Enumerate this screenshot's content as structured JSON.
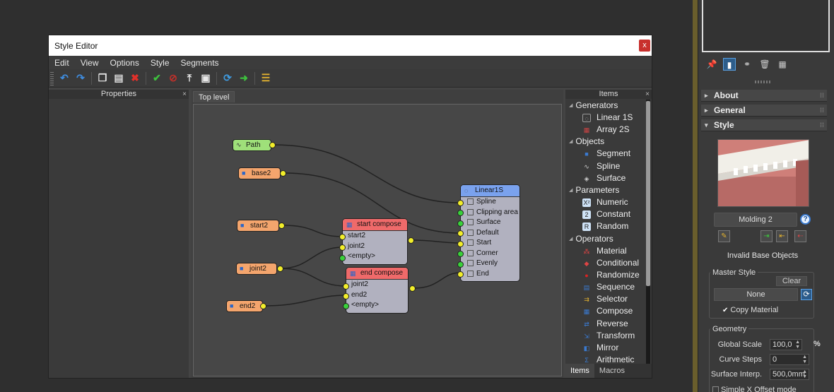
{
  "window": {
    "title": "Style Editor",
    "close_label": "x"
  },
  "menu": [
    "Edit",
    "View",
    "Options",
    "Style",
    "Segments"
  ],
  "panels": {
    "properties": "Properties",
    "items": "Items",
    "top_tab": "Top level"
  },
  "graph": {
    "inputs": {
      "path": "Path",
      "base2": "base2",
      "start2": "start2",
      "joint2": "joint2",
      "end2": "end2"
    },
    "start_compose": {
      "title": "start compose",
      "ports": [
        "start2",
        "joint2",
        "<empty>"
      ]
    },
    "end_compose": {
      "title": "end compose",
      "ports": [
        "joint2",
        "end2",
        "<empty>"
      ]
    },
    "linear": {
      "title": "Linear1S",
      "ports": [
        "Spline",
        "Clipping area",
        "Surface",
        "Default",
        "Start",
        "Corner",
        "Evenly",
        "End"
      ]
    }
  },
  "items": [
    {
      "category": "Generators",
      "entries": [
        {
          "label": "Linear 1S",
          "icon": "linear-icon"
        },
        {
          "label": "Array 2S",
          "icon": "array-icon"
        }
      ]
    },
    {
      "category": "Objects",
      "entries": [
        {
          "label": "Segment",
          "icon": "segment-icon"
        },
        {
          "label": "Spline",
          "icon": "spline-icon"
        },
        {
          "label": "Surface",
          "icon": "surface-icon"
        }
      ]
    },
    {
      "category": "Parameters",
      "entries": [
        {
          "label": "Numeric",
          "icon": "numeric-icon"
        },
        {
          "label": "Constant",
          "icon": "constant-icon"
        },
        {
          "label": "Random",
          "icon": "random-icon"
        }
      ]
    },
    {
      "category": "Operators",
      "entries": [
        {
          "label": "Material",
          "icon": "material-icon"
        },
        {
          "label": "Conditional",
          "icon": "conditional-icon"
        },
        {
          "label": "Randomize",
          "icon": "randomize-icon"
        },
        {
          "label": "Sequence",
          "icon": "sequence-icon"
        },
        {
          "label": "Selector",
          "icon": "selector-icon"
        },
        {
          "label": "Compose",
          "icon": "compose-icon"
        },
        {
          "label": "Reverse",
          "icon": "reverse-icon"
        },
        {
          "label": "Transform",
          "icon": "transform-icon"
        },
        {
          "label": "Mirror",
          "icon": "mirror-icon"
        },
        {
          "label": "Arithmetic",
          "icon": "arithmetic-icon"
        }
      ]
    }
  ],
  "items_tabs": {
    "items": "Items",
    "macros": "Macros"
  },
  "right_panel": {
    "rollouts": {
      "about": "About",
      "general": "General",
      "style": "Style"
    },
    "style_name": "Molding 2",
    "status": "Invalid Base Objects",
    "master_style": {
      "label": "Master Style",
      "clear": "Clear",
      "value": "None",
      "copy_material": "Copy Material"
    },
    "geometry": {
      "label": "Geometry",
      "global_scale_label": "Global Scale",
      "global_scale": "100,0",
      "curve_steps_label": "Curve Steps",
      "curve_steps": "0",
      "surface_interp_label": "Surface Interp.",
      "surface_interp": "500,0mm",
      "unit": "%"
    },
    "bottom_option": "Simple X Offset mode"
  }
}
